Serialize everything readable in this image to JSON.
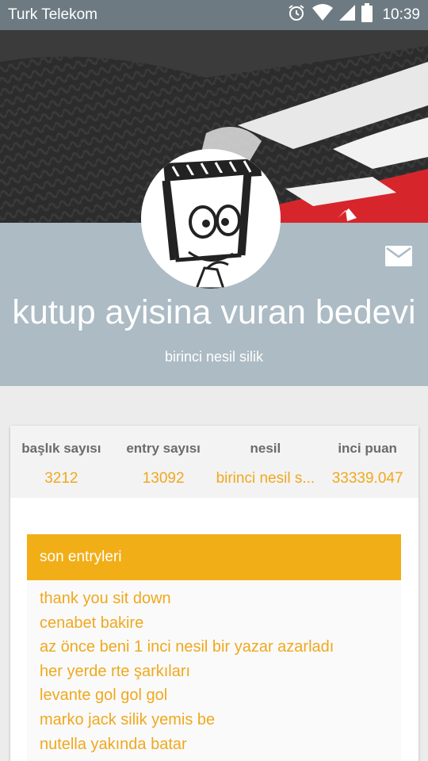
{
  "status_bar": {
    "carrier": "Turk Telekom",
    "time": "10:39",
    "icons": [
      "alarm-icon",
      "wifi-icon",
      "signal-icon",
      "battery-icon"
    ]
  },
  "profile": {
    "username": "kutup ayisina vuran bedevi",
    "generation_label": "birinci nesil silik",
    "message_icon": "mail-icon"
  },
  "stats": [
    {
      "label": "başlık sayısı",
      "value": "3212"
    },
    {
      "label": "entry sayısı",
      "value": "13092"
    },
    {
      "label": "nesil",
      "value": "birinci nesil s..."
    },
    {
      "label": "inci puan",
      "value": "33339.047"
    }
  ],
  "recent_entries": {
    "title": "son entryleri",
    "items": [
      "thank you sit down",
      "cenabet bakire",
      "az önce beni 1 inci nesil bir yazar azarladı",
      "her yerde rte şarkıları",
      "levante gol gol gol",
      "marko jack silik yemis be",
      "nutella yakında batar"
    ]
  },
  "colors": {
    "status_bar": "#6d7a82",
    "profile_band": "#acbbc4",
    "accent": "#f1ae17",
    "background": "#ececec"
  }
}
